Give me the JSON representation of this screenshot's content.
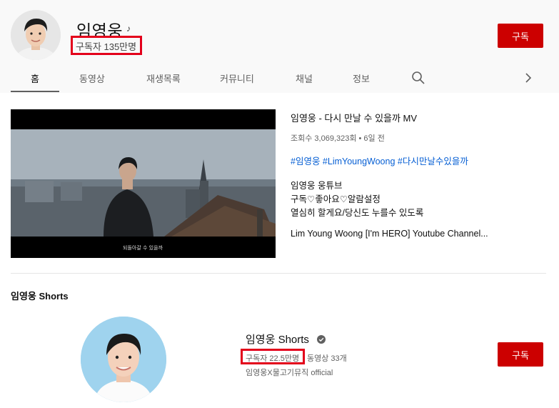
{
  "channel": {
    "name": "임영웅",
    "subscribers": "구독자 135만명",
    "subscribe_label": "구독"
  },
  "tabs": [
    {
      "label": "홈",
      "active": true
    },
    {
      "label": "동영상"
    },
    {
      "label": "재생목록"
    },
    {
      "label": "커뮤니티"
    },
    {
      "label": "채널"
    },
    {
      "label": "정보"
    }
  ],
  "featured_video": {
    "title": "임영웅 - 다시 만날 수 있을까 MV",
    "meta": "조회수 3,069,323회 • 6일 전",
    "hashtags": "#임영웅 #LimYoungWoong #다시만날수있을까",
    "subtitle": "되돌아갈 수 있을까",
    "description": [
      "임영웅 웅튜브",
      "구독♡좋아요♡알람설정",
      "열심히 할게요/당신도 누를수 있도록",
      "",
      "Lim Young Woong  [I'm HERO] Youtube Channel..."
    ]
  },
  "shorts_section": {
    "title": "임영웅 Shorts",
    "channel_name": "임영웅 Shorts",
    "subscribers": "구독자 22.5만명",
    "videos": "동영상 33개",
    "handle": "임영웅X물고기뮤직 official",
    "subscribe_label": "구독"
  },
  "colors": {
    "subscribe": "#cc0000",
    "highlight_box": "#e3001b",
    "hashtag": "#065fd4"
  },
  "icons": [
    "music-note-icon",
    "search-icon",
    "chevron-right-icon",
    "verified-icon"
  ]
}
